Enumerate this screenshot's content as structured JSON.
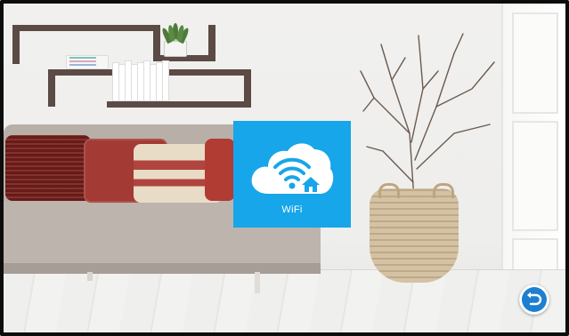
{
  "app_tile": {
    "label": "WiFi",
    "icon": "wifi-cloud-home-icon",
    "color": "#17a6e9"
  },
  "navigation": {
    "back_icon": "back-arrow-icon",
    "back_color": "#1d7fd0"
  }
}
